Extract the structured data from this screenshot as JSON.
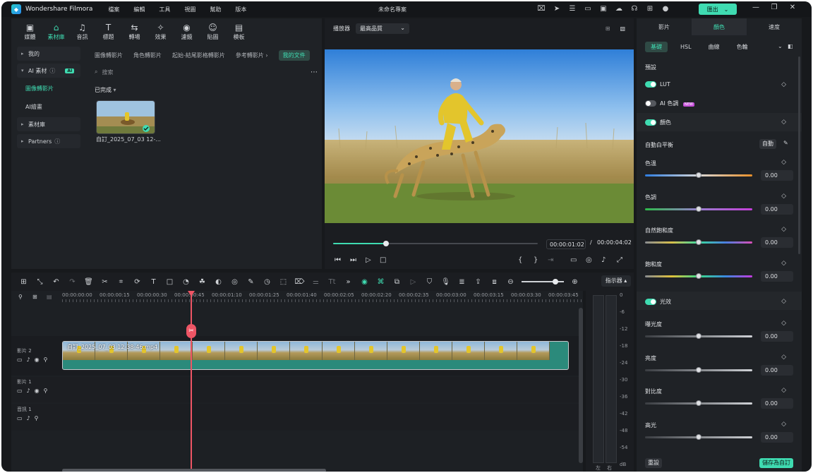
{
  "app": {
    "name": "Wondershare Filmora",
    "menu": [
      "檔案",
      "編輯",
      "工具",
      "視圖",
      "幫助",
      "版本"
    ],
    "project_title": "未命名專案",
    "export_label": "匯出"
  },
  "media_tabs": [
    {
      "icon": "media-icon",
      "glyph": "▣",
      "label": "媒體"
    },
    {
      "icon": "stock-icon",
      "glyph": "⌂",
      "label": "素材庫"
    },
    {
      "icon": "audio-icon",
      "glyph": "♫",
      "label": "音訊"
    },
    {
      "icon": "title-icon",
      "glyph": "T",
      "label": "標題"
    },
    {
      "icon": "transition-icon",
      "glyph": "⇆",
      "label": "轉場"
    },
    {
      "icon": "effects-icon",
      "glyph": "✧",
      "label": "效果"
    },
    {
      "icon": "filter-icon",
      "glyph": "◉",
      "label": "濾鏡"
    },
    {
      "icon": "sticker-icon",
      "glyph": "☺",
      "label": "貼圖"
    },
    {
      "icon": "template-icon",
      "glyph": "▤",
      "label": "模板"
    }
  ],
  "sidebar": {
    "mine": "我的",
    "ai_stock": "AI 素材",
    "ai_badge": "AI",
    "image_to_video": "圖像轉影片",
    "ai_image": "AI繪畫",
    "stock": "素材庫",
    "partners": "Partners"
  },
  "library_tabs": [
    "圖像轉影片",
    "角色轉影片",
    "起始-結尾影格轉影片",
    "參考轉影片 ›",
    "我的文件"
  ],
  "search_placeholder": "搜索",
  "completed_label": "已完成",
  "thumbnail_name": "自訂_2025_07_03 12-...",
  "player": {
    "label": "播放器",
    "quality": "最高品質",
    "current_time": "00:00:01:02",
    "separator": "/",
    "total_time": "00:00:04:02",
    "progress": 0.26
  },
  "right_panel": {
    "tabs": [
      "影片",
      "顏色",
      "速度"
    ],
    "subtabs": [
      "基礎",
      "HSL",
      "曲線",
      "色輪"
    ],
    "preset": "預設",
    "lut": "LUT",
    "ai_color": "AI 色調",
    "new_badge": "NEW",
    "color": "顏色",
    "auto_wb": "自動白平衡",
    "auto_btn": "自動",
    "light": "光效",
    "reset": "重設",
    "save_custom": "儲存為自訂",
    "sliders": [
      {
        "label": "色溫",
        "value": "0.00"
      },
      {
        "label": "色調",
        "value": "0.00"
      },
      {
        "label": "自然飽和度",
        "value": "0.00"
      },
      {
        "label": "飽和度",
        "value": "0.00"
      },
      {
        "label": "曝光度",
        "value": "0.00"
      },
      {
        "label": "亮度",
        "value": "0.00"
      },
      {
        "label": "對比度",
        "value": "0.00"
      },
      {
        "label": "高光",
        "value": "0.00"
      }
    ]
  },
  "timeline": {
    "ruler": [
      "00:00:00:00",
      "00:00:00:15",
      "00:00:00:30",
      "00:00:00:45",
      "00:00:01:10",
      "00:00:01:25",
      "00:00:01:40",
      "00:00:02:05",
      "00:00:02:20",
      "00:00:02:35",
      "00:00:03:00",
      "00:00:03:15",
      "00:00:03:30",
      "00:00:03:45"
    ],
    "tracks": [
      "影片 2",
      "影片 1",
      "音訊 1"
    ],
    "clip_name": "自訂_2025_07_03 12-38-46.mp4"
  },
  "meter": {
    "label": "指示器",
    "scale": [
      "0",
      "-6",
      "-12",
      "-18",
      "-24",
      "-30",
      "-36",
      "-42",
      "-48",
      "-54",
      "dB"
    ],
    "left": "左",
    "right": "右"
  },
  "colors": {
    "accent": "#3fdbb1",
    "playhead": "#ee5565"
  }
}
